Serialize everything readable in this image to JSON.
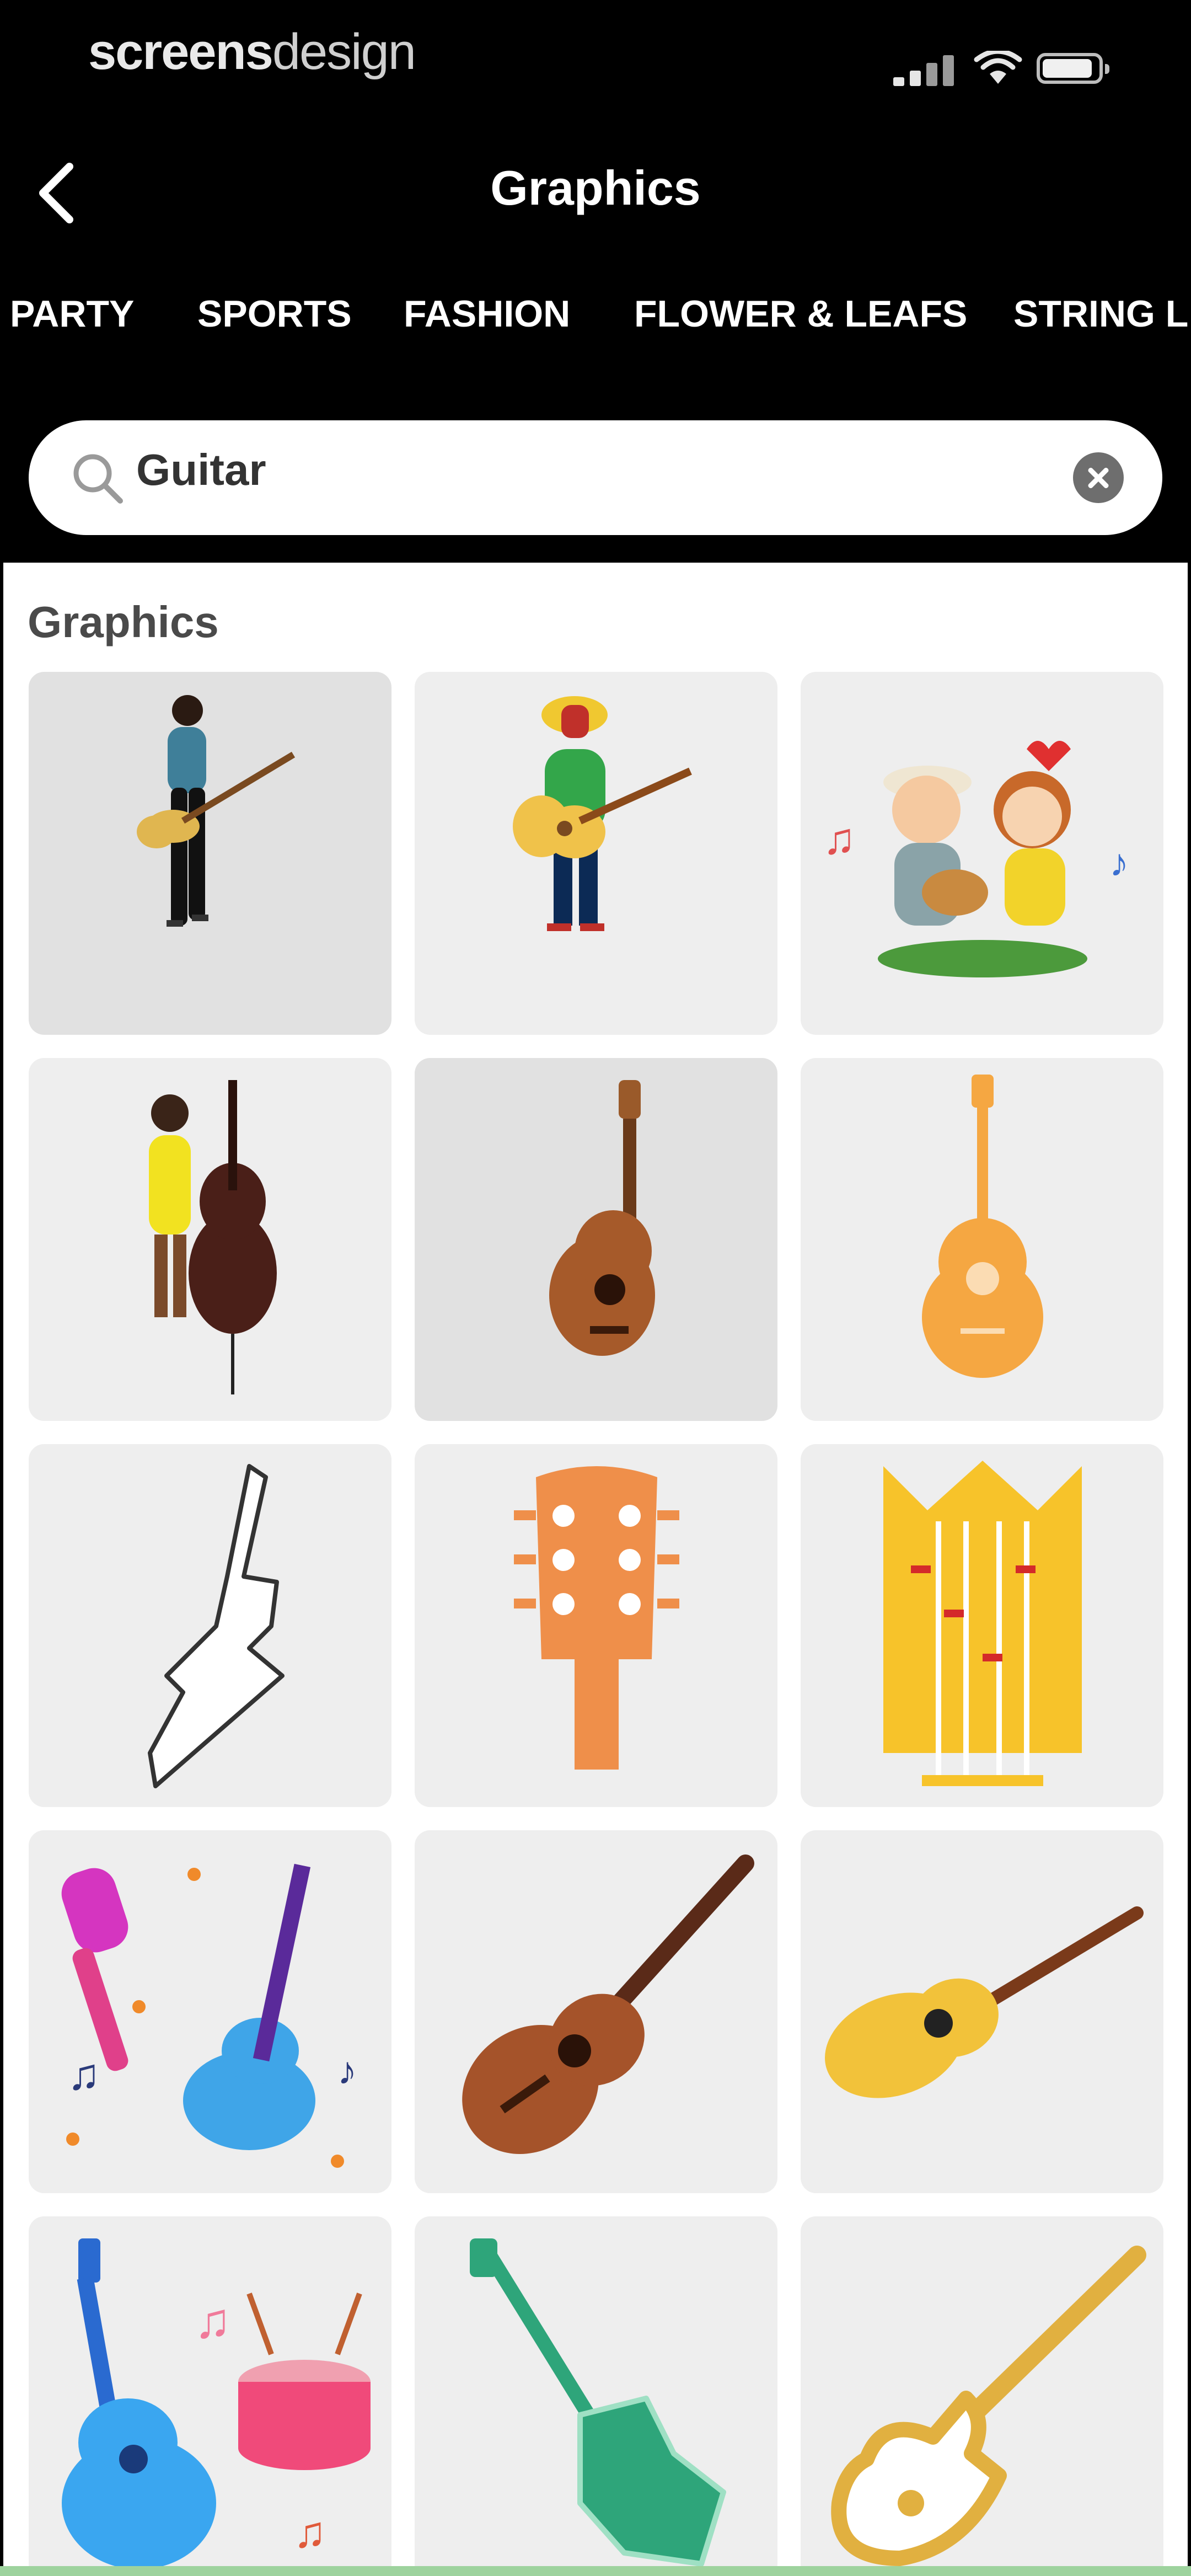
{
  "status_bar": {
    "carrier_bold": "screens",
    "carrier_light": "design"
  },
  "header": {
    "title": "Graphics"
  },
  "tabs": [
    "PARTY",
    "SPORTS",
    "FASHION",
    "FLOWER & LEAFS",
    "STRING L"
  ],
  "search": {
    "value": "Guitar"
  },
  "section": {
    "title": "Graphics"
  },
  "graphics": [
    {
      "icon": "guitarist-photo-icon"
    },
    {
      "icon": "reggae-guitarist-icon"
    },
    {
      "icon": "couple-playing-guitar-icon"
    },
    {
      "icon": "woman-with-double-bass-icon"
    },
    {
      "icon": "ukulele-photo-icon"
    },
    {
      "icon": "orange-acoustic-guitar-icon"
    },
    {
      "icon": "electric-guitar-outline-icon"
    },
    {
      "icon": "guitar-headstock-icon"
    },
    {
      "icon": "guitar-headstock-crown-icon"
    },
    {
      "icon": "microphone-and-guitar-icon"
    },
    {
      "icon": "brown-acoustic-guitar-icon"
    },
    {
      "icon": "yellow-guitar-icon"
    },
    {
      "icon": "guitar-and-drum-icon"
    },
    {
      "icon": "green-electric-guitar-icon"
    },
    {
      "icon": "gold-electric-guitar-icon"
    }
  ],
  "colors": {
    "background": "#000000",
    "panel": "#ffffff",
    "tile": "#eeeeee",
    "accent_orange": "#f5a742"
  }
}
